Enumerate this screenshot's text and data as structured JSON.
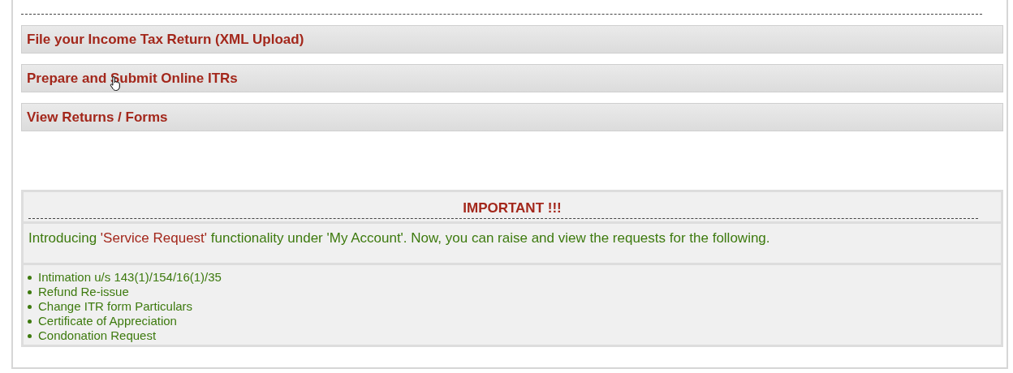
{
  "sections": [
    {
      "label": "File your Income Tax Return (XML Upload)"
    },
    {
      "label": "Prepare and Submit Online ITRs"
    },
    {
      "label": "View Returns / Forms"
    }
  ],
  "notice": {
    "title": "IMPORTANT !!!",
    "intro": {
      "before": "Introducing ",
      "highlight": "'Service Request'",
      "after": " functionality under 'My Account'. Now, you can raise and view the requests for the following."
    },
    "items": [
      "Intimation u/s 143(1)/154/16(1)/35",
      "Refund Re-issue",
      "Change ITR form Particulars",
      "Certificate of Appreciation",
      "Condonation Request"
    ]
  }
}
